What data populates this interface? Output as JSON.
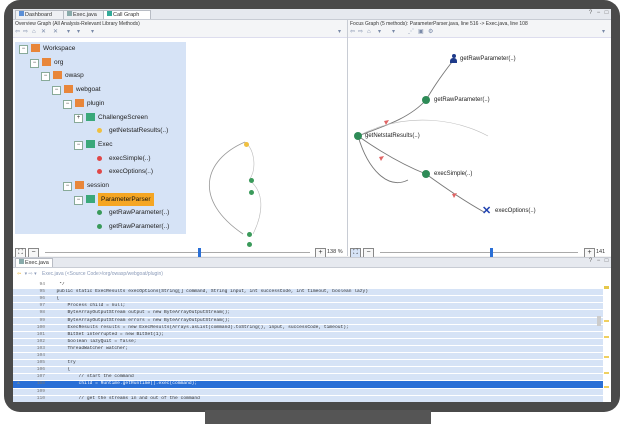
{
  "tabs": [
    {
      "label": "Dashboard",
      "active": false
    },
    {
      "label": "Exec.java",
      "active": false
    },
    {
      "label": "Call Graph",
      "active": true
    }
  ],
  "left_pane": {
    "header": "Overview Graph (All Analysis-Relevant Library Methods)",
    "zoom_label": "138 %"
  },
  "tree": [
    {
      "label": "Workspace",
      "depth": 0,
      "kind": "folder",
      "toggle": "−"
    },
    {
      "label": "org",
      "depth": 1,
      "kind": "folder",
      "toggle": "−"
    },
    {
      "label": "owasp",
      "depth": 2,
      "kind": "folder",
      "toggle": "−"
    },
    {
      "label": "webgoat",
      "depth": 3,
      "kind": "folder",
      "toggle": "−"
    },
    {
      "label": "plugin",
      "depth": 4,
      "kind": "folder",
      "toggle": "−"
    },
    {
      "label": "ChallengeScreen",
      "depth": 5,
      "kind": "class",
      "toggle": "+"
    },
    {
      "label": "getNetstatResults(..)",
      "depth": 6,
      "kind": "method-yellow"
    },
    {
      "label": "Exec",
      "depth": 5,
      "kind": "class",
      "toggle": "−"
    },
    {
      "label": "execSimple(..)",
      "depth": 6,
      "kind": "method-red"
    },
    {
      "label": "execOptions(..)",
      "depth": 6,
      "kind": "method-red"
    },
    {
      "label": "session",
      "depth": 4,
      "kind": "folder",
      "toggle": "−"
    },
    {
      "label": "ParameterParser",
      "depth": 5,
      "kind": "class-selected",
      "toggle": "−"
    },
    {
      "label": "getRawParameter(..)",
      "depth": 6,
      "kind": "method-green"
    },
    {
      "label": "getRawParameter(..)",
      "depth": 6,
      "kind": "method-green"
    }
  ],
  "right_pane": {
    "header": "Focus Graph (5 methods): ParameterParser.java, line 516 -> Exec.java, line 108",
    "zoom_label": "141 %",
    "nodes": [
      {
        "id": "n1",
        "label": "getRawParameter(..)",
        "kind": "person"
      },
      {
        "id": "n2",
        "label": "getRawParameter(..)",
        "kind": "green"
      },
      {
        "id": "n3",
        "label": "getNetstatResults(..)",
        "kind": "green"
      },
      {
        "id": "n4",
        "label": "execSimple(..)",
        "kind": "green"
      },
      {
        "id": "n5",
        "label": "execOptions(..)",
        "kind": "cross"
      }
    ]
  },
  "editor": {
    "tab_label": "Exec.java",
    "breadcrumb": "Exec.java (<Source Code>/org/owasp/webgoat/plugin)",
    "lines": [
      {
        "n": "94",
        "text": "   */",
        "style": ""
      },
      {
        "n": "95",
        "text": "  public static ExecResults execOptions(String[] command, String input, int successCode, int timeout, boolean lazy)",
        "style": "sel"
      },
      {
        "n": "96",
        "text": "  {",
        "style": "sel"
      },
      {
        "n": "97",
        "text": "      Process child = null;",
        "style": "sel"
      },
      {
        "n": "98",
        "text": "      ByteArrayOutputStream output = new ByteArrayOutputStream();",
        "style": "sel"
      },
      {
        "n": "99",
        "text": "      ByteArrayOutputStream errors = new ByteArrayOutputStream();",
        "style": "sel"
      },
      {
        "n": "100",
        "text": "      ExecResults results = new ExecResults(Arrays.asList(command).toString(), input, successCode, timeout);",
        "style": "sel"
      },
      {
        "n": "101",
        "text": "      BitSet interrupted = new BitSet(1);",
        "style": "sel"
      },
      {
        "n": "102",
        "text": "      boolean lazyQuit = false;",
        "style": "sel"
      },
      {
        "n": "103",
        "text": "      ThreadWatcher watcher;",
        "style": "sel"
      },
      {
        "n": "104",
        "text": "",
        "style": "sel"
      },
      {
        "n": "105",
        "text": "      try",
        "style": "sel"
      },
      {
        "n": "106",
        "text": "      {",
        "style": "sel"
      },
      {
        "n": "107",
        "text": "          // start the command",
        "style": "sel"
      },
      {
        "n": "108",
        "text": "          child = Runtime.getRuntime().exec(command);",
        "style": "hl"
      },
      {
        "n": "109",
        "text": "",
        "style": "sel"
      },
      {
        "n": "110",
        "text": "          // get the streams in and out of the command",
        "style": "sel"
      }
    ]
  },
  "colors": {
    "accent": "#2a6fd6",
    "tree_bg": "#d6e3f6",
    "node_green": "#2e8b57",
    "edge_red": "#e06666"
  }
}
